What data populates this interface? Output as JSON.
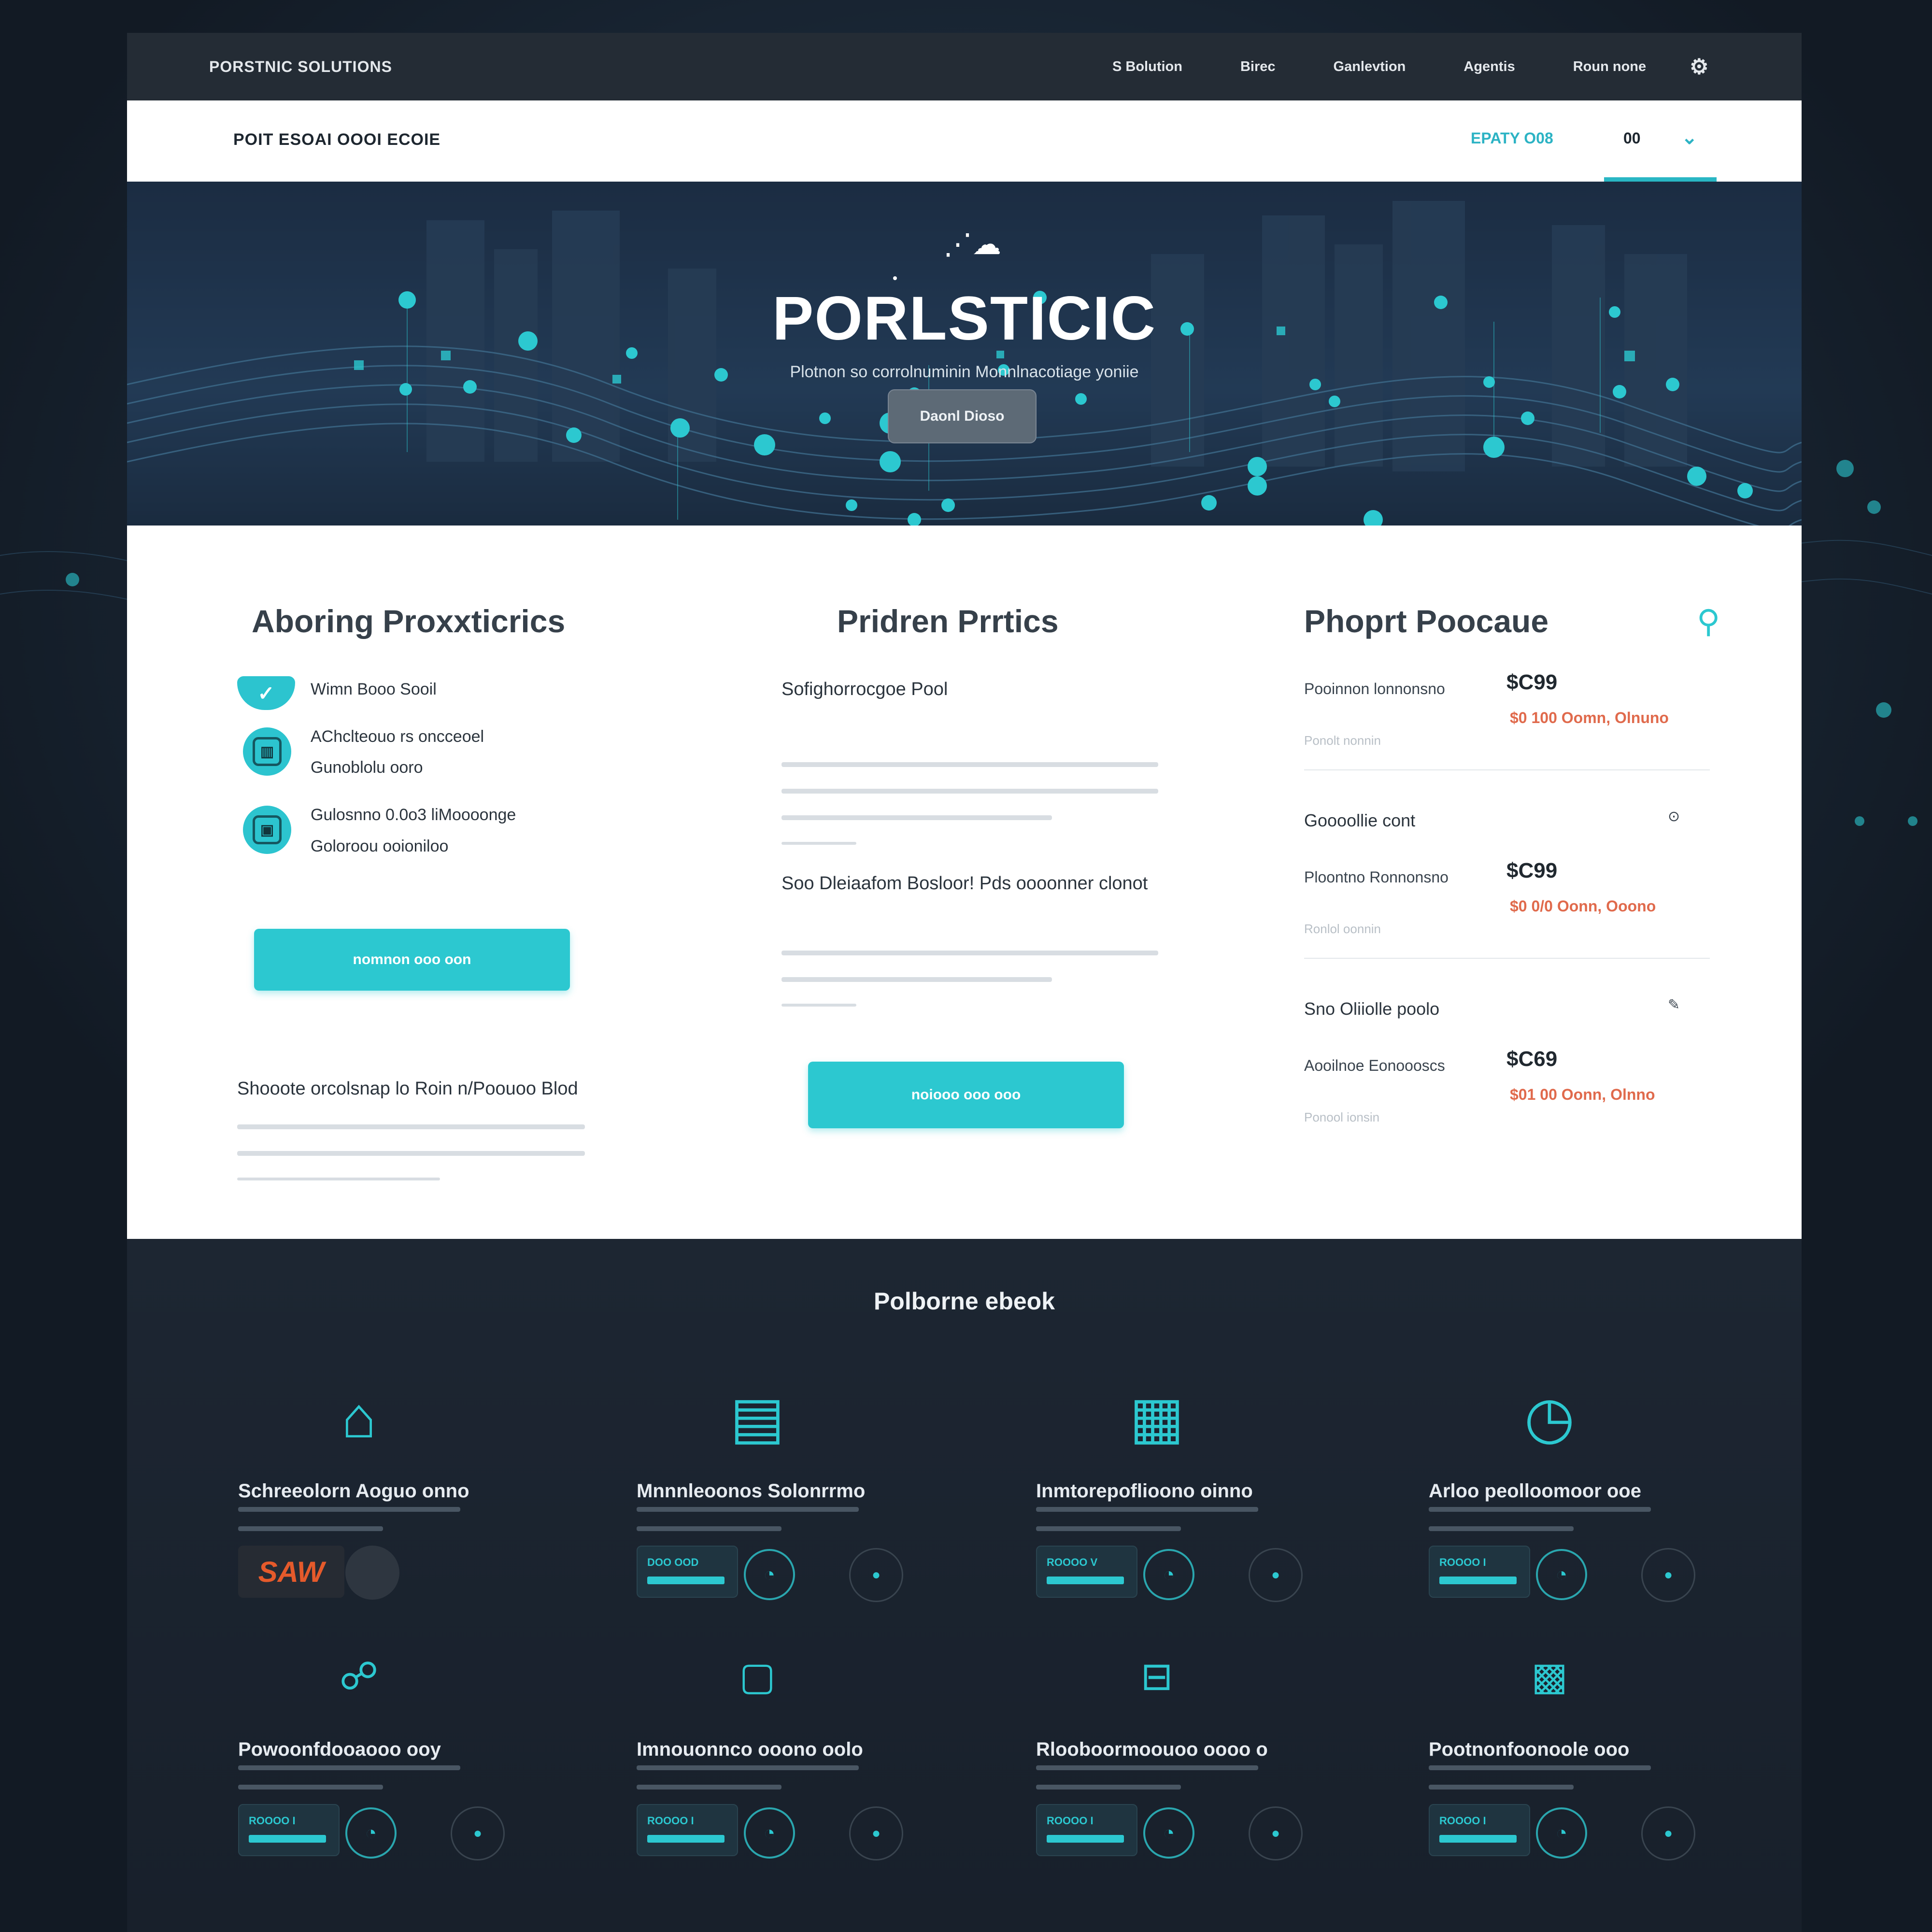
{
  "topbar": {
    "brand": "PORSTNIC SOLUTIONS",
    "nav": [
      "S Bolution",
      "Birec",
      "Ganlevtion",
      "Agentis",
      "Roun none"
    ],
    "icon": "settings-icon"
  },
  "subbar": {
    "breadcrumb": "POIT ESOAI OOOI ECOIE",
    "nav_label": "EPATY O08",
    "tab_label": "00",
    "tab_icon": "chevron-down-icon"
  },
  "hero": {
    "title": "PORLSTICIC",
    "subtitle": "Plotnon so corrolnuminin Monnlnacotiage yoniie",
    "button": "Daonl Dioso"
  },
  "col1": {
    "heading": "Aboring Proxxticrics",
    "features": [
      {
        "icon": "check-icon",
        "line1": "Wimn Booo Sooil",
        "line2": ""
      },
      {
        "icon": "app-icon",
        "line1": "AChclteouo rs oncceoel",
        "line2": "Gunoblolu ooro"
      },
      {
        "icon": "box-icon",
        "line1": "Gulosnno 0.0o3 liMoooonge",
        "line2": "Goloroou ooioniloo"
      }
    ],
    "button": "nomnon ooo oon",
    "subheading": "Shooote orcolsnap lo Roin n/Poouoo Blod"
  },
  "col2": {
    "heading": "Pridren Prrtics",
    "block1_heading": "Sofighorrocgoe Pool",
    "block2_heading": "Soo Dleiaafom Bosloor! Pds oooonner clonot",
    "button": "noiooo ooo ooo"
  },
  "col3": {
    "heading": "Phoprt Poocaue",
    "pin_icon": "map-pin-icon",
    "items": [
      {
        "group": "",
        "label": "Pooinnon lonnonsno",
        "price": "$C99",
        "old": "$0 100 Oomn, Olnuno",
        "note": "Ponolt nonnin"
      },
      {
        "group": "Goooollie cont",
        "label": "Ploontno Ronnonsno",
        "price": "$C99",
        "old": "$0 0/0 Oonn, Ooono",
        "note": "Ronlol oonnin"
      },
      {
        "group": "Sno Oliiolle poolo",
        "label": "Aooilnoe Eonoooscs",
        "price": "$C69",
        "old": "$01 00 Oonn, Olnno",
        "note": "Ponool ionsin"
      }
    ]
  },
  "lower": {
    "title": "Polborne ebeok",
    "cards": [
      {
        "icon": "home-icon",
        "title": "Schreeolorn Aoguo onno",
        "chip_text": "",
        "style": "orange",
        "orange_text": "SAW"
      },
      {
        "icon": "terminal-icon",
        "title": "Mnnnleoonos Solonrrmo",
        "chip_text": "DOO OOD",
        "style": "teal"
      },
      {
        "icon": "apps-icon",
        "title": "Inmtorepoflioono oinno",
        "chip_text": "ROOOO V",
        "style": "teal"
      },
      {
        "icon": "clock-icon",
        "title": "Arloo peolloomoor ooe",
        "chip_text": "ROOOO I",
        "style": "teal"
      },
      {
        "icon": "link-icon",
        "title": "Powoonfdooaooo ooy",
        "chip_text": "ROOOO I",
        "style": "teal"
      },
      {
        "icon": "frame-icon",
        "title": "Imnouonnco ooono oolo",
        "chip_text": "ROOOO I",
        "style": "teal"
      },
      {
        "icon": "panel-icon",
        "title": "Rlooboormoouoo oooo o",
        "chip_text": "ROOOO I",
        "style": "teal"
      },
      {
        "icon": "grid-icon",
        "title": "Pootnonfoonoole ooo",
        "chip_text": "ROOOO I",
        "style": "teal"
      }
    ]
  },
  "colors": {
    "accent": "#2cc8d0",
    "price_old": "#e06a4c",
    "dark": "#1a2430"
  }
}
